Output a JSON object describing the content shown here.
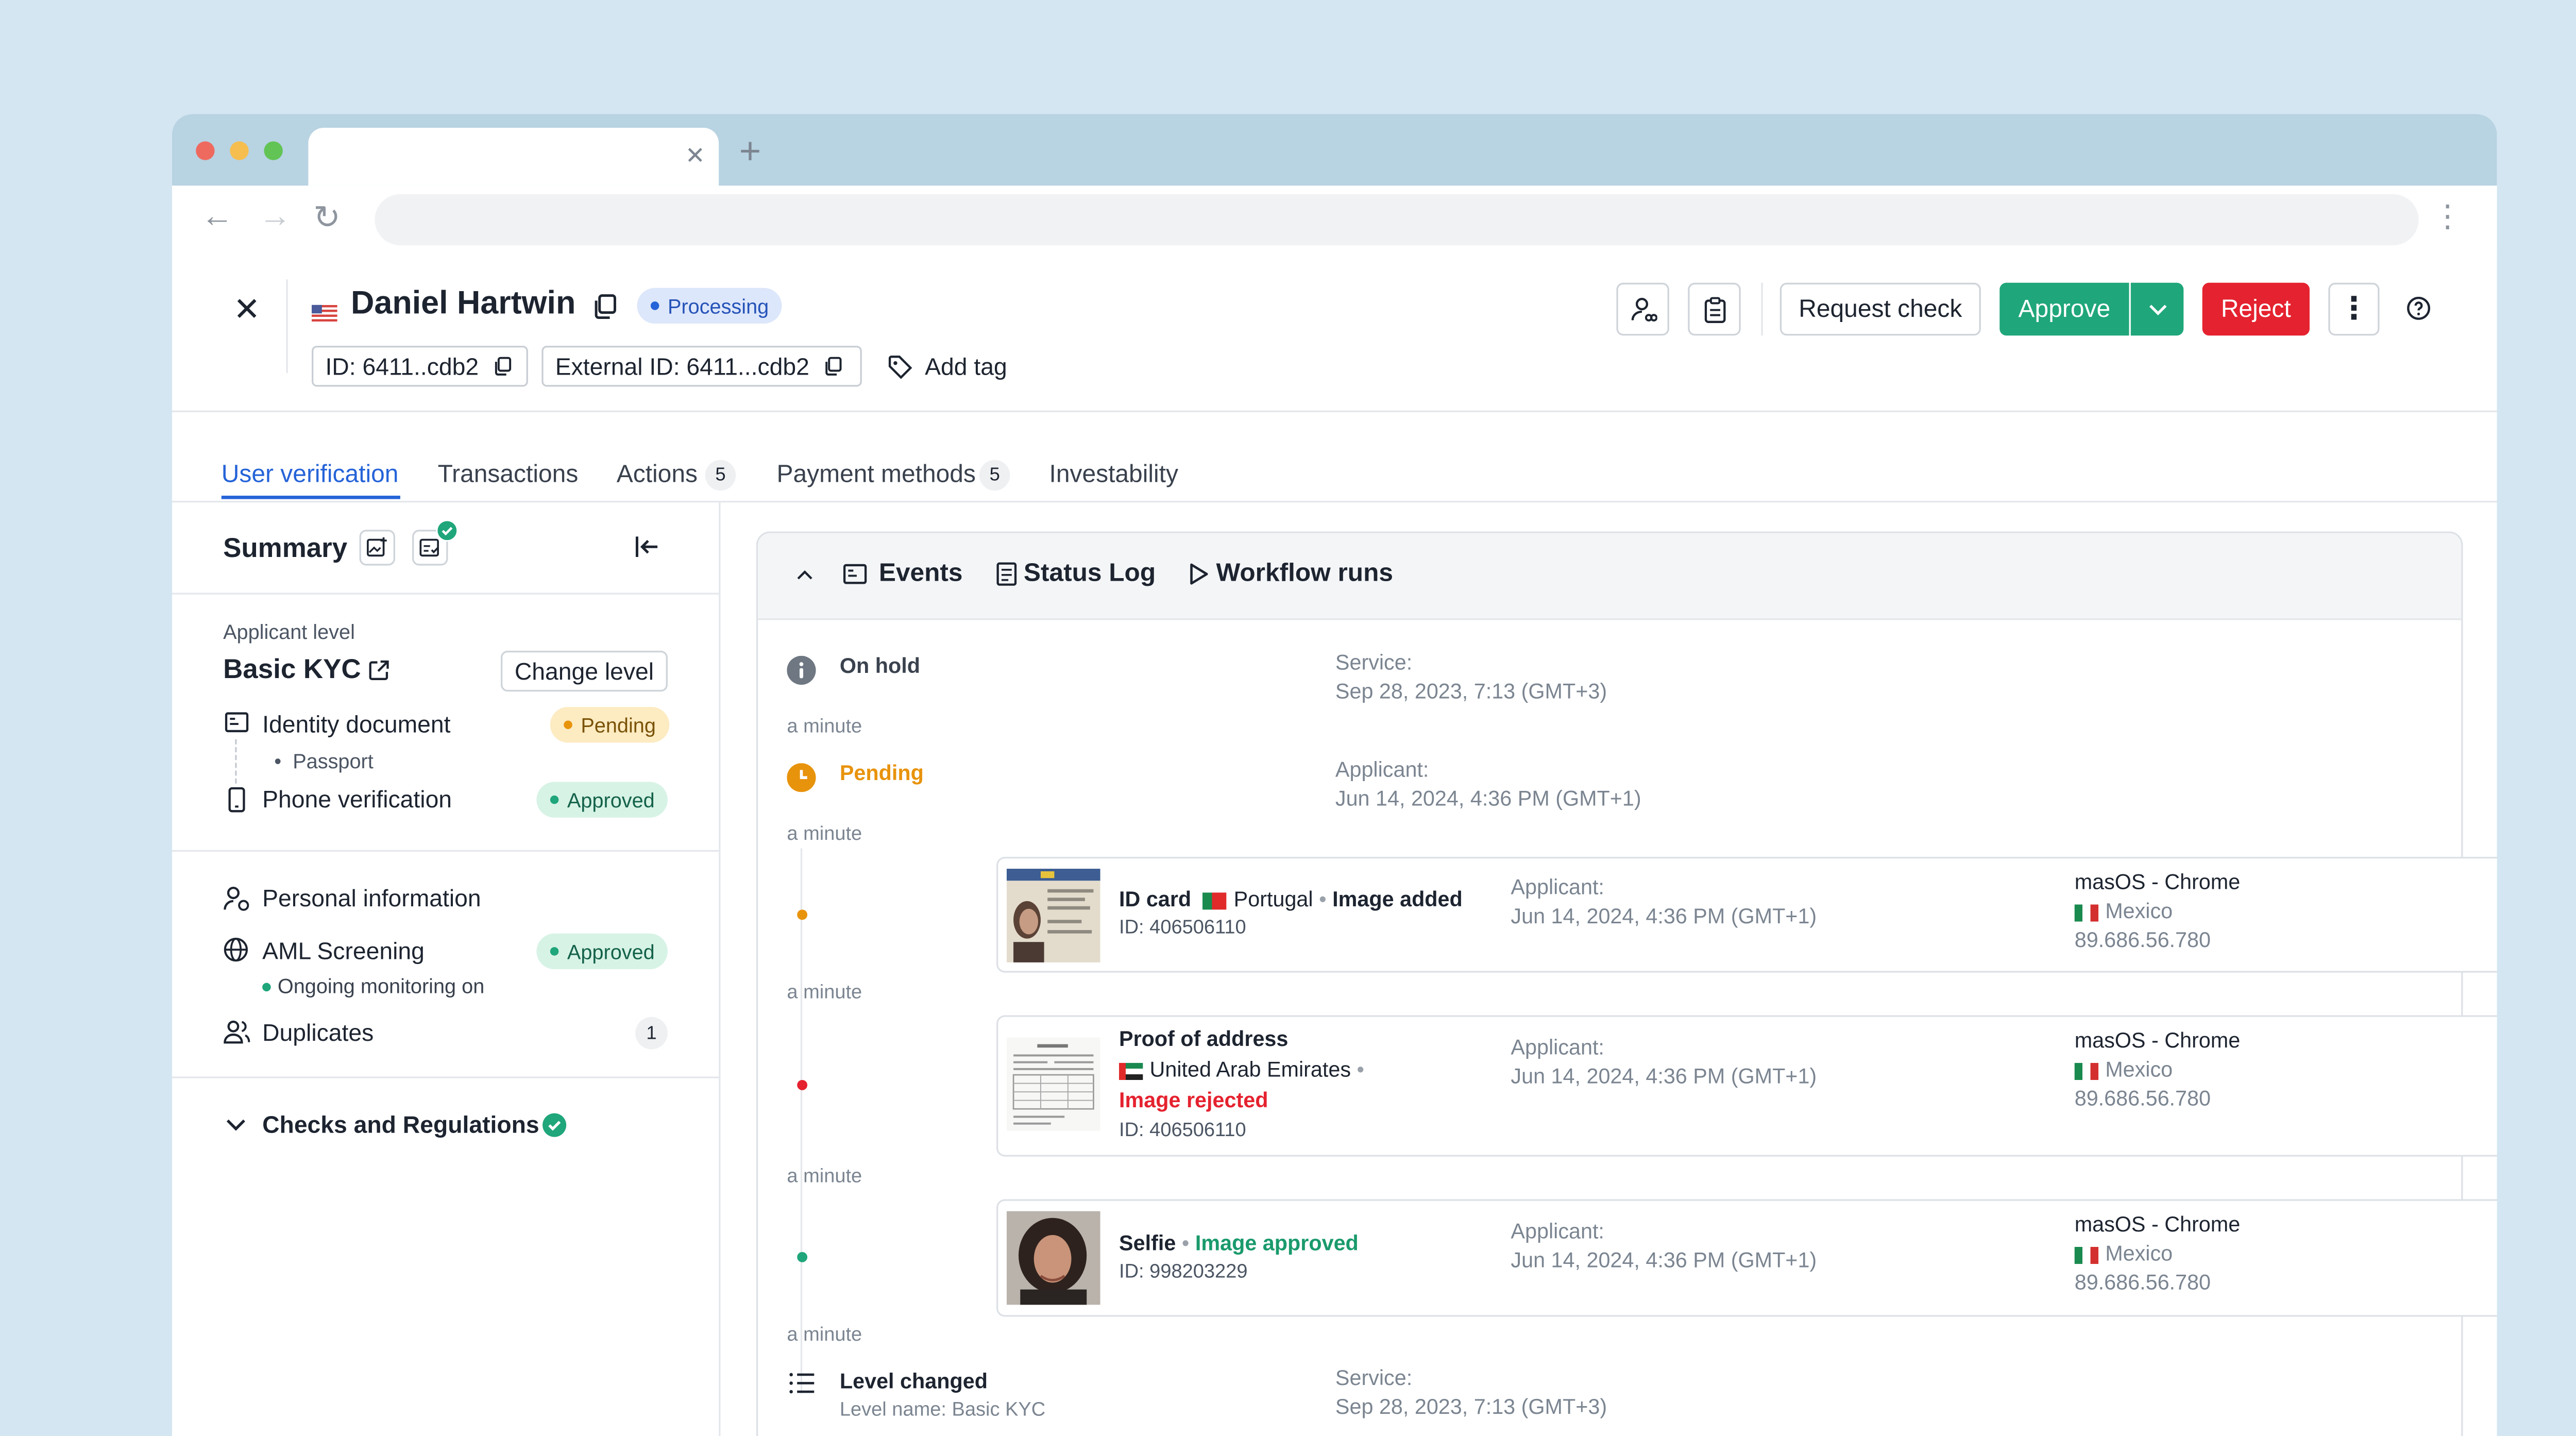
{
  "applicant": {
    "name": "Daniel Hartwin",
    "status": "Processing",
    "id": "ID: 6411..cdb2",
    "external_id": "External ID: 6411...cdb2",
    "add_tag": "Add tag"
  },
  "toolbar": {
    "request_check": "Request check",
    "approve": "Approve",
    "reject": "Reject"
  },
  "tabs": [
    {
      "label": "User verification"
    },
    {
      "label": "Transactions"
    },
    {
      "label": "Actions",
      "count": "5"
    },
    {
      "label": "Payment methods",
      "count": "5"
    },
    {
      "label": "Investability"
    }
  ],
  "summary": {
    "title": "Summary",
    "level_label": "Applicant level",
    "level_name": "Basic KYC",
    "change_level": "Change level",
    "identity_document": "Identity document",
    "identity_status": "Pending",
    "passport": "Passport",
    "phone_verification": "Phone verification",
    "phone_status": "Approved",
    "personal_information": "Personal information",
    "aml_screening": "AML Screening",
    "aml_status": "Approved",
    "monitoring": "Ongoing monitoring on",
    "duplicates": "Duplicates",
    "duplicates_count": "1",
    "checks": "Checks and Regulations"
  },
  "panel_tabs": {
    "events": "Events",
    "status_log": "Status Log",
    "workflow_runs": "Workflow runs"
  },
  "events": {
    "on_hold": {
      "title": "On hold",
      "source": "Service:",
      "time": "Sep 28, 2023, 7:13 (GMT+3)"
    },
    "gap1": "a minute",
    "pending": {
      "title": "Pending",
      "source": "Applicant:",
      "time": "Jun 14, 2024, 4:36 PM (GMT+1)"
    },
    "gap2": "a minute",
    "id_card": {
      "title": "ID card",
      "country": "Portugal",
      "result": "Image added",
      "id": "ID: 406506110",
      "source": "Applicant:",
      "time": "Jun 14, 2024, 4:36 PM (GMT+1)",
      "device": "masOS - Chrome",
      "geo": "Mexico",
      "ip": "89.686.56.780"
    },
    "gap3": "a minute",
    "address": {
      "title": "Proof of address",
      "country": "United Arab Emirates",
      "result": "Image rejected",
      "id": "ID: 406506110",
      "source": "Applicant:",
      "time": "Jun 14, 2024, 4:36 PM (GMT+1)",
      "device": "masOS - Chrome",
      "geo": "Mexico",
      "ip": "89.686.56.780"
    },
    "gap4": "a minute",
    "selfie": {
      "title": "Selfie",
      "result": "Image approved",
      "id": "ID: 998203229",
      "source": "Applicant:",
      "time": "Jun 14, 2024, 4:36 PM (GMT+1)",
      "device": "masOS - Chrome",
      "geo": "Mexico",
      "ip": "89.686.56.780"
    },
    "gap5": "a minute",
    "level_changed": {
      "title": "Level changed",
      "detail": "Level name: Basic KYC",
      "source": "Service:",
      "time": "Sep 28, 2023, 7:13 (GMT+3)"
    }
  },
  "colors": {
    "accent": "#2563d8",
    "approve": "#1fa67a",
    "reject": "#e5222f",
    "pending": "#e8930c"
  }
}
